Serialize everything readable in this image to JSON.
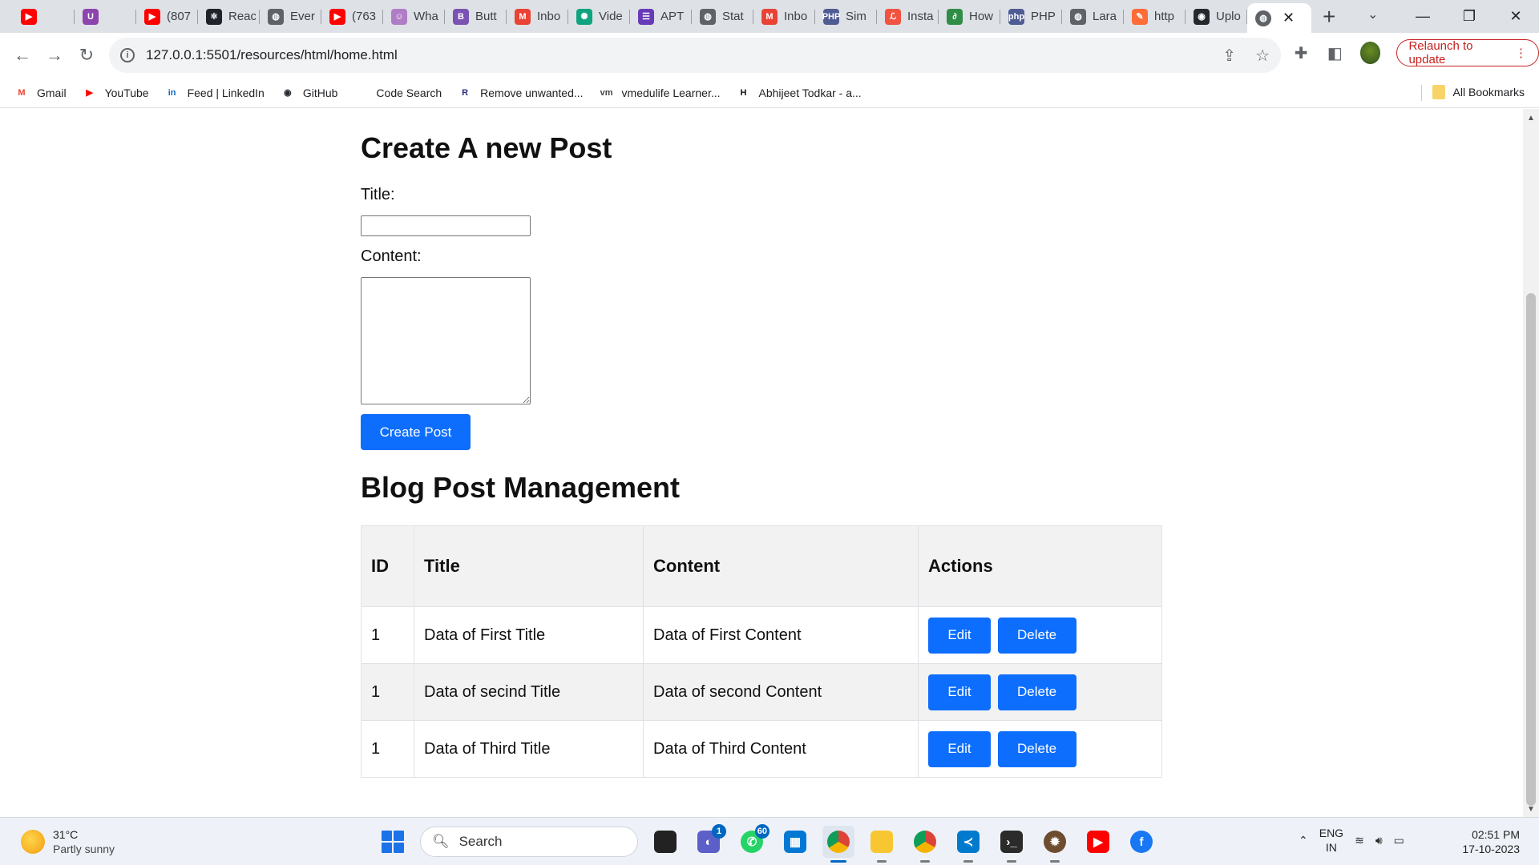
{
  "browser": {
    "tabs": [
      {
        "label": "",
        "icon": "youtube-icon",
        "color": "#ff0000",
        "glyph": "▶"
      },
      {
        "label": "",
        "icon": "app-icon",
        "color": "#8e44ad",
        "glyph": "U"
      },
      {
        "label": "(807",
        "icon": "youtube-icon",
        "color": "#ff0000",
        "glyph": "▶"
      },
      {
        "label": "Reac",
        "icon": "react-icon",
        "color": "#20232a",
        "glyph": "⚛"
      },
      {
        "label": "Ever",
        "icon": "globe-icon",
        "color": "#5f6368",
        "glyph": "◍"
      },
      {
        "label": "(763",
        "icon": "youtube-icon",
        "color": "#ff0000",
        "glyph": "▶"
      },
      {
        "label": "Wha",
        "icon": "avatar-icon",
        "color": "#b07cc6",
        "glyph": "☺"
      },
      {
        "label": "Butt",
        "icon": "bootstrap-icon",
        "color": "#7952b3",
        "glyph": "B"
      },
      {
        "label": "Inbo",
        "icon": "gmail-icon",
        "color": "#ea4335",
        "glyph": "M"
      },
      {
        "label": "Vide",
        "icon": "openai-icon",
        "color": "#10a37f",
        "glyph": "✺"
      },
      {
        "label": "APT",
        "icon": "form-icon",
        "color": "#673ab7",
        "glyph": "☰"
      },
      {
        "label": "Stat",
        "icon": "globe-icon",
        "color": "#5f6368",
        "glyph": "◍"
      },
      {
        "label": "Inbo",
        "icon": "gmail-icon",
        "color": "#ea4335",
        "glyph": "M"
      },
      {
        "label": "Sim",
        "icon": "php-icon",
        "color": "#4f5b93",
        "glyph": "PHP"
      },
      {
        "label": "Insta",
        "icon": "laravel-icon",
        "color": "#f05340",
        "glyph": "ℒ"
      },
      {
        "label": "How",
        "icon": "geeks-icon",
        "color": "#2f8d46",
        "glyph": "∂"
      },
      {
        "label": "PHP",
        "icon": "php-icon",
        "color": "#4f5b93",
        "glyph": "php"
      },
      {
        "label": "Lara",
        "icon": "globe-icon",
        "color": "#5f6368",
        "glyph": "◍"
      },
      {
        "label": "http",
        "icon": "postman-icon",
        "color": "#ff6c37",
        "glyph": "✎"
      },
      {
        "label": "Uplo",
        "icon": "github-icon",
        "color": "#24292e",
        "glyph": "◉"
      }
    ],
    "active_tab_icon": "globe-icon",
    "url": "127.0.0.1:5501/resources/html/home.html",
    "relaunch_label": "Relaunch to update",
    "bookmarks": [
      {
        "label": "Gmail",
        "icon": "gmail-icon",
        "color": "#ea4335",
        "glyph": "M"
      },
      {
        "label": "YouTube",
        "icon": "youtube-icon",
        "color": "#ff0000",
        "glyph": "▶"
      },
      {
        "label": "Feed | LinkedIn",
        "icon": "linkedin-icon",
        "color": "#0a66c2",
        "glyph": "in"
      },
      {
        "label": "GitHub",
        "icon": "github-icon",
        "color": "#24292e",
        "glyph": "◉"
      },
      {
        "label": "Code Search",
        "icon": "blank-icon",
        "color": "#ffffff",
        "glyph": ""
      },
      {
        "label": "Remove unwanted...",
        "icon": "r-icon",
        "color": "#2b2d7f",
        "glyph": "R"
      },
      {
        "label": "vmedulife Learner...",
        "icon": "vm-icon",
        "color": "#444444",
        "glyph": "vm"
      },
      {
        "label": "Abhijeet Todkar - a...",
        "icon": "hr-icon",
        "color": "#111111",
        "glyph": "H"
      }
    ],
    "all_bookmarks_label": "All Bookmarks"
  },
  "page": {
    "create_heading": "Create A new Post",
    "title_label": "Title:",
    "title_value": "",
    "content_label": "Content:",
    "content_value": "",
    "create_button": "Create Post",
    "management_heading": "Blog Post Management",
    "table": {
      "headers": [
        "ID",
        "Title",
        "Content",
        "Actions"
      ],
      "rows": [
        {
          "id": "1",
          "title": "Data of First Title",
          "content": "Data of First Content"
        },
        {
          "id": "1",
          "title": "Data of secind Title",
          "content": "Data of second Content"
        },
        {
          "id": "1",
          "title": "Data of Third Title",
          "content": "Data of Third Content"
        }
      ],
      "edit_label": "Edit",
      "delete_label": "Delete"
    },
    "accent_color": "#0d6efd"
  },
  "taskbar": {
    "weather_temp": "31°C",
    "weather_desc": "Partly sunny",
    "search_placeholder": "Search",
    "teams_badge": "1",
    "whatsapp_badge": "60",
    "lang_top": "ENG",
    "lang_bottom": "IN",
    "time": "02:51 PM",
    "date": "17-10-2023"
  }
}
